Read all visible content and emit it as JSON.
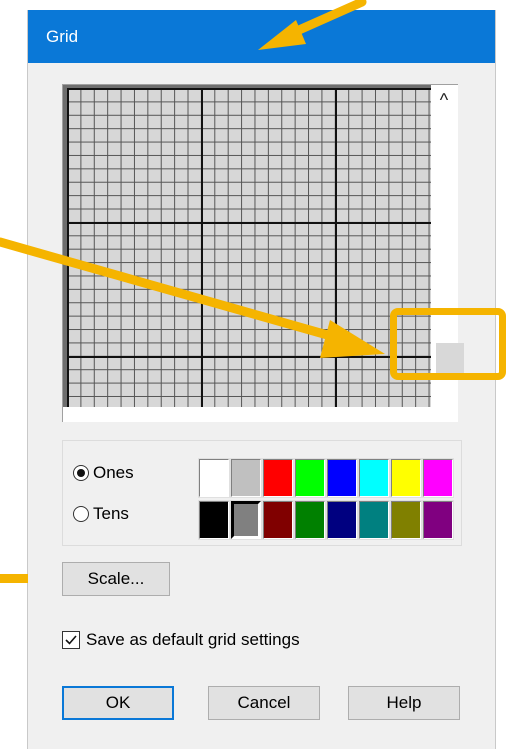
{
  "window": {
    "title": "Grid"
  },
  "grid_preview": {
    "scroll_up_glyph": "^"
  },
  "grid_type": {
    "options": [
      {
        "label": "Ones",
        "checked": true
      },
      {
        "label": "Tens",
        "checked": false
      }
    ]
  },
  "palette": {
    "row1": [
      "#ffffff",
      "#c0c0c0",
      "#ff0000",
      "#00ff00",
      "#0000ff",
      "#00ffff",
      "#ffff00",
      "#ff00ff"
    ],
    "row2": [
      "#000000",
      "#808080",
      "#800000",
      "#008000",
      "#000080",
      "#008080",
      "#808000",
      "#800080"
    ],
    "selected": "#808080"
  },
  "buttons": {
    "scale": "Scale...",
    "ok": "OK",
    "cancel": "Cancel",
    "help": "Help"
  },
  "checkbox": {
    "label": "Save as default grid settings",
    "checked": true
  },
  "annotation_color": "#f5b400",
  "accent": "#0a78d7"
}
